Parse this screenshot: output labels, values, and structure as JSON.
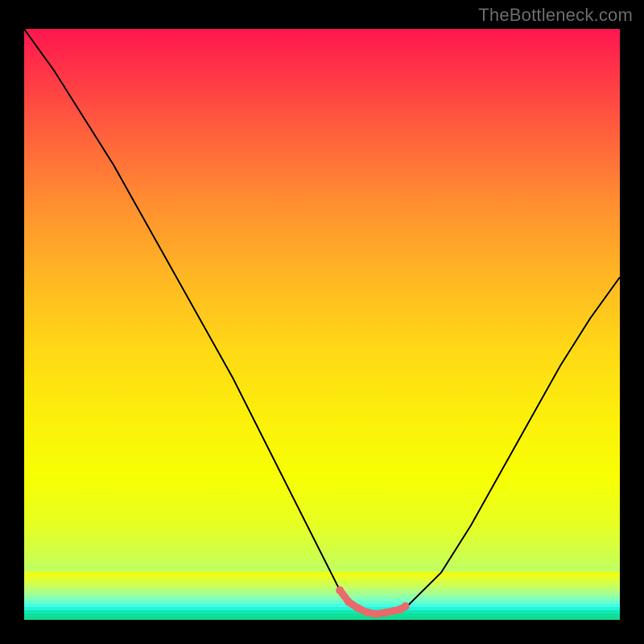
{
  "watermark": "TheBottleneck.com",
  "chart_data": {
    "type": "line",
    "title": "",
    "xlabel": "",
    "ylabel": "",
    "xlim": [
      0,
      100
    ],
    "ylim": [
      0,
      100
    ],
    "grid": false,
    "series": [
      {
        "name": "curve",
        "x": [
          0,
          5,
          10,
          15,
          20,
          25,
          30,
          35,
          40,
          45,
          50,
          53,
          56,
          59,
          62,
          64,
          70,
          75,
          80,
          85,
          90,
          95,
          100
        ],
        "y": [
          100,
          93,
          85,
          77,
          68,
          59,
          50,
          41,
          31,
          21,
          11,
          5,
          2,
          1,
          1,
          2,
          8,
          16,
          25,
          34,
          43,
          51,
          58
        ],
        "color": "#000000"
      },
      {
        "name": "valley-marker",
        "x": [
          53,
          54.5,
          56,
          57.5,
          59,
          60.5,
          62,
          63.2,
          64
        ],
        "y": [
          5,
          3,
          2,
          1.3,
          1,
          1.2,
          1.5,
          1.8,
          2.3
        ],
        "color": "#e96a6a"
      }
    ],
    "annotations": []
  },
  "bottom_bands": [
    "#f2ff11",
    "#e9ff23",
    "#dfff35",
    "#d4ff49",
    "#c8ff5e",
    "#baff74",
    "#aaff8c",
    "#97ffa3",
    "#81ffba",
    "#66ffcf",
    "#46ffe2",
    "#24f5d9",
    "#11e8b0",
    "#0fe09a",
    "#10da8e"
  ]
}
